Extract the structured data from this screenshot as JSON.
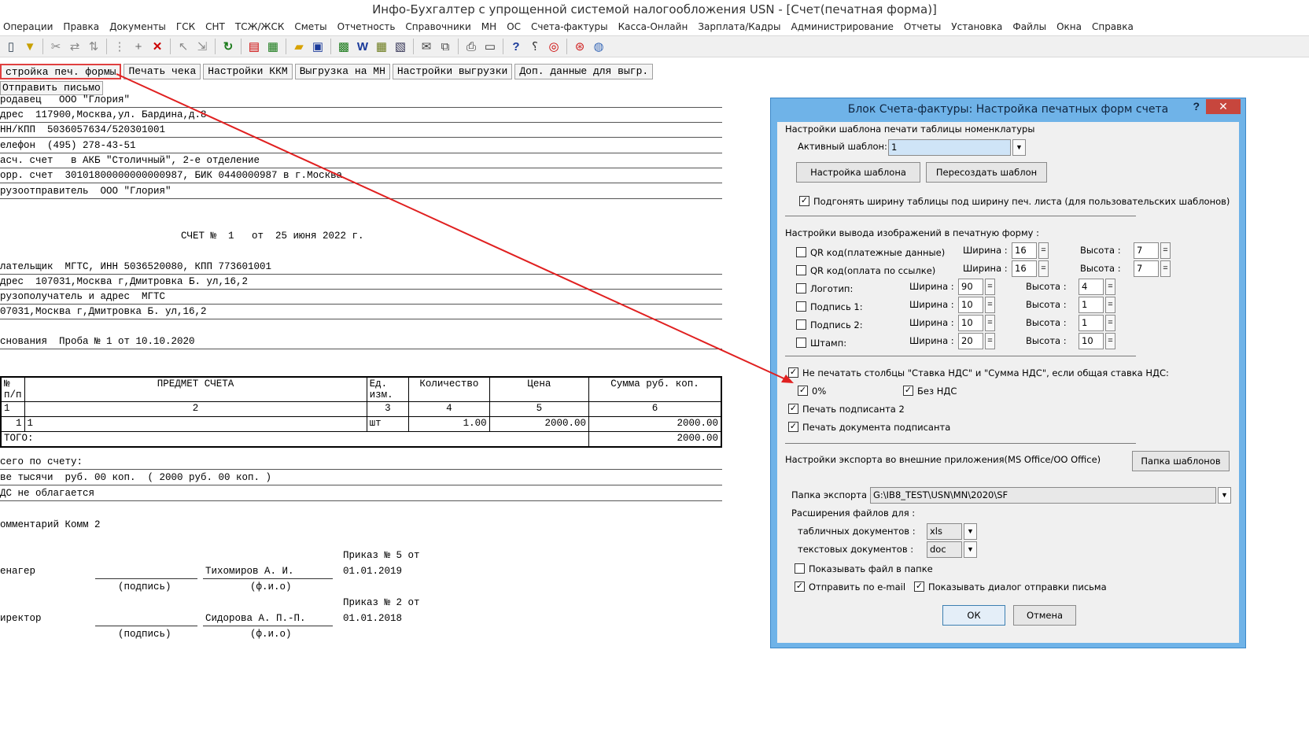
{
  "window": {
    "title": "Инфо-Бухгалтер с упрощенной системой налогообложения   USN   - [Счет(печатная форма)]"
  },
  "menu": [
    "Операции",
    "Правка",
    "Документы",
    "ГСК",
    "СНТ",
    "ТСЖ/ЖСК",
    "Сметы",
    "Отчетность",
    "Справочники",
    "МН",
    "ОС",
    "Счета-фактуры",
    "Касса-Онлайн",
    "Зарплата/Кадры",
    "Администрирование",
    "Отчеты",
    "Установка",
    "Файлы",
    "Окна",
    "Справка"
  ],
  "toolbar": {
    "icons": [
      "filter-icon",
      "cut-icon",
      "scissors-icon",
      "sort-icon",
      "add-icon",
      "delete-icon",
      "pointer-icon",
      "refresh-icon",
      "pdf-icon",
      "calculator-icon",
      "folder-open-icon",
      "save-icon",
      "excel-icon",
      "word-icon",
      "doc-icon",
      "copy-icon",
      "print-icon",
      "help-icon",
      "context-help-icon",
      "compass-icon",
      "lifebuoy-icon",
      "globe-icon"
    ]
  },
  "doc_buttons": {
    "print_form_settings": "стройка печ. формы",
    "print_receipt": "Печать чека",
    "kkm_settings": "Настройки ККМ",
    "export_mn": "Выгрузка на МН",
    "export_settings": "Настройки выгрузки",
    "extra_export_data": "Доп. данные для выгр.",
    "send_letter": "Отправить письмо"
  },
  "invoice": {
    "seller": "родавец   ООО \"Глория\"",
    "address": "дрес  117900,Москва,ул. Бардина,д.8",
    "inn_kpp": "НН/КПП  5036057634/520301001",
    "phone": "елефон  (495) 278-43-51",
    "account": "асч. счет   в АКБ \"Столичный\", 2-е отделение",
    "corr_account": "орр. счет  30101800000000000987, БИК 0440000987 в г.Москва",
    "shipper": "рузоотправитель  ООО \"Глория\"",
    "invoice_title": "СЧЕТ №  1   от  25 июня 2022 г.",
    "payer": "лательщик  МГТС, ИНН 5036520080, КПП 773601001",
    "payer_address": "дрес  107031,Москва г,Дмитровка Б. ул,16,2",
    "consignee": "рузополучатель и адрес  МГТС",
    "consignee_address": "07031,Москва г,Дмитровка Б. ул,16,2",
    "basis": "снования  Проба № 1 от 10.10.2020",
    "table": {
      "headers": {
        "num": "№\nп/п",
        "subject": "ПРЕДМЕТ СЧЕТА",
        "unit": "Ед.\nизм.",
        "qty": "Количество",
        "price": "Цена",
        "sum": "Сумма  руб.   коп."
      },
      "col_numbers": [
        "1",
        "2",
        "3",
        "4",
        "5",
        "6"
      ],
      "row": {
        "num": "1",
        "subject": "1",
        "unit": "шт",
        "qty": "1.00",
        "price": "2000.00",
        "sum": "2000.00"
      },
      "total_label": "ТОГО:",
      "total_value": "2000.00"
    },
    "total_text": "сего по счету:",
    "total_words": "ве тысячи  руб. 00 коп.  ( 2000 руб. 00 коп. )",
    "vat_text": "ДС не облагается",
    "comment": "омментарий Комм 2",
    "manager_order_1": "Приказ № 5 от",
    "manager_order_2": "01.01.2019",
    "manager_role": "енагер",
    "manager_name": "Тихомиров А. И.",
    "director_order_1": "Приказ № 2 от",
    "director_order_2": "01.01.2018",
    "director_role": "иректор",
    "director_name": "Сидорова А. П.-П.",
    "sign_label": "(подпись)",
    "name_label": "(ф.и.о)"
  },
  "dialog": {
    "title": "Блок Счета-фактуры: Настройка печатных форм счета",
    "help": "?",
    "close": "✕",
    "sections": {
      "template": "Настройки шаблона печати таблицы номенклатуры",
      "images": "Настройки вывода изображений в печатную  форму   :",
      "export": "Настройки экспорта во внешние приложения(MS Office/OO Office)"
    },
    "active_template_label": "Активный шаблон:",
    "active_template_value": "1",
    "template_settings_btn": "Настройка шаблона",
    "recreate_template_btn": "Пересоздать шаблон",
    "fit_width_label": "Подгонять ширину таблицы под ширину печ. листа (для пользовательских шаблонов)",
    "width_label": "Ширина :",
    "height_label": "Высота :",
    "eq": "=",
    "images": [
      {
        "label": "QR код(платежные данные)",
        "width": "16",
        "height": "7"
      },
      {
        "label": "QR код(оплата по ссылке)",
        "width": "16",
        "height": "7"
      },
      {
        "label": "Логотип:",
        "width": "90",
        "height": "4"
      },
      {
        "label": "Подпись 1:",
        "width": "10",
        "height": "1"
      },
      {
        "label": "Подпись 2:",
        "width": "10",
        "height": "1"
      },
      {
        "label": "Штамп:",
        "width": "20",
        "height": "10"
      }
    ],
    "no_vat_columns_label": "Не печатать столбцы \"Ставка НДС\" и \"Сумма НДС\", если общая ставка НДС:",
    "vat_zero_label": "0%",
    "vat_none_label": "Без НДС",
    "print_signer2_label": "Печать подписанта 2",
    "print_signer_doc_label": "Печать документа подписанта",
    "template_folder_btn": "Папка шаблонов",
    "export_folder_label": "Папка экспорта :",
    "export_folder_value": "G:\\IB8_TEST\\USN\\MN\\2020\\SF",
    "extensions_label": "Расширения файлов для        :",
    "table_docs_label": "табличных документов       :",
    "table_docs_value": "xls",
    "text_docs_label": "текстовых документов       :",
    "text_docs_value": "doc",
    "show_in_folder_label": "Показывать файл в папке",
    "send_email_label": "Отправить по e-mail",
    "show_send_dialog_label": "Показывать диалог отправки письма",
    "ok": "ОК",
    "cancel": "Отмена",
    "check": "✓"
  },
  "colors": {
    "arrow": "#e02020",
    "dialog_frame": "#6fb3e8",
    "close_button": "#c7463d"
  }
}
